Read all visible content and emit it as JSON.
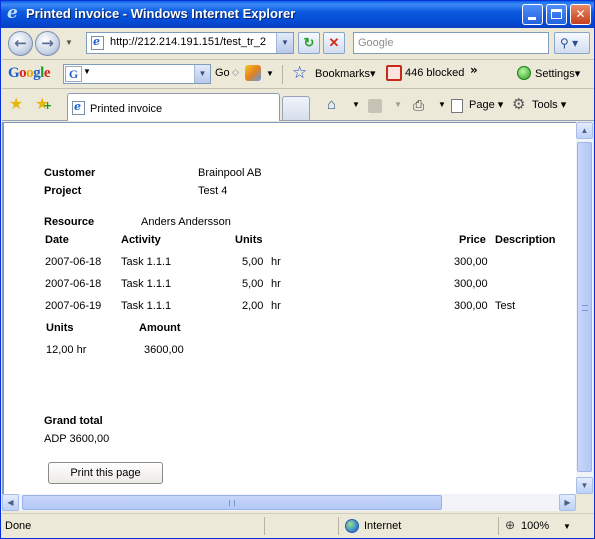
{
  "window": {
    "title": "Printed invoice - Windows Internet Explorer"
  },
  "address": {
    "url": "http://212.214.191.151/test_tr_2",
    "search_placeholder": "Google"
  },
  "google_toolbar": {
    "logo": "Google",
    "go_label": "Go",
    "bookmarks_label": "Bookmarks",
    "blocked_label": "446 blocked",
    "more_label": "»",
    "settings_label": "Settings"
  },
  "tab": {
    "label": "Printed invoice"
  },
  "commands": {
    "page_label": "Page",
    "tools_label": "Tools"
  },
  "invoice": {
    "customer_label": "Customer",
    "customer_value": "Brainpool AB",
    "project_label": "Project",
    "project_value": "Test 4",
    "resource_label": "Resource",
    "resource_value": "Anders Andersson",
    "columns": {
      "date": "Date",
      "activity": "Activity",
      "units": "Units",
      "price": "Price",
      "description": "Description"
    },
    "rows": [
      {
        "date": "2007-06-18",
        "activity": "Task 1.1.1",
        "units": "5,00",
        "unit": "hr",
        "price": "300,00",
        "description": ""
      },
      {
        "date": "2007-06-18",
        "activity": "Task 1.1.1",
        "units": "5,00",
        "unit": "hr",
        "price": "300,00",
        "description": ""
      },
      {
        "date": "2007-06-19",
        "activity": "Task 1.1.1",
        "units": "2,00",
        "unit": "hr",
        "price": "300,00",
        "description": "Test"
      }
    ],
    "summary": {
      "units_label": "Units",
      "amount_label": "Amount",
      "units_value": "12,00 hr",
      "amount_value": "3600,00"
    },
    "grand_total_label": "Grand total",
    "grand_total_value": "ADP 3600,00",
    "print_button": "Print this page"
  },
  "status": {
    "text": "Done",
    "zone": "Internet",
    "zoom": "100%"
  },
  "colors": {
    "titlebar": "#0a5fe8",
    "chrome": "#ece9d8",
    "page": "#ffffff"
  },
  "icons": [
    "ie-logo-icon",
    "back-icon",
    "forward-icon",
    "refresh-icon",
    "stop-icon",
    "search-icon",
    "star-icon",
    "add-favorite-icon",
    "home-icon",
    "feed-icon",
    "print-icon",
    "page-icon",
    "tools-icon",
    "globe-icon",
    "zoom-icon"
  ]
}
